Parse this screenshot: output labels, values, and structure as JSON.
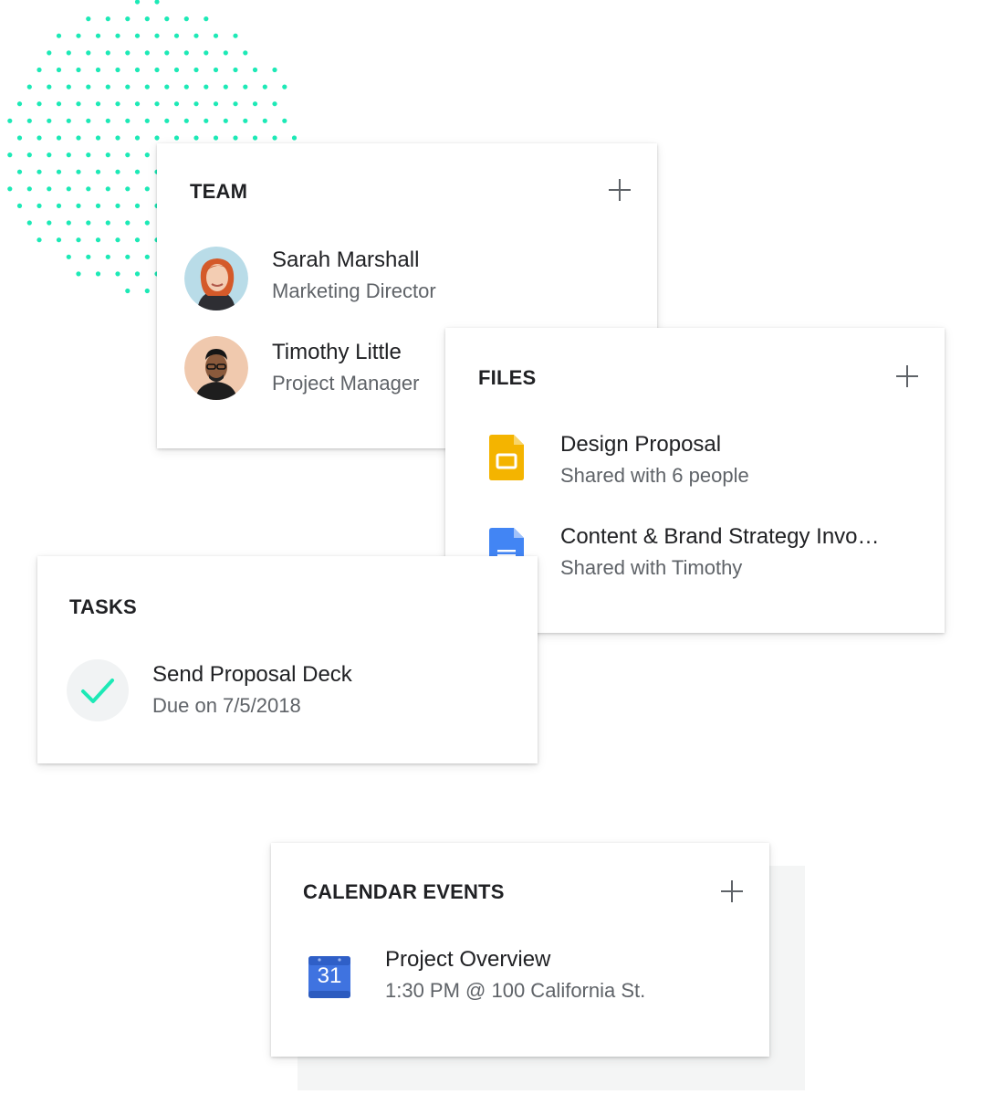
{
  "team": {
    "title": "TEAM",
    "members": [
      {
        "name": "Sarah Marshall",
        "role": "Marketing Director"
      },
      {
        "name": "Timothy Little",
        "role": "Project Manager"
      }
    ]
  },
  "files": {
    "title": "FILES",
    "items": [
      {
        "name": "Design Proposal",
        "detail": "Shared with 6 people",
        "icon": "google-slides-icon"
      },
      {
        "name": "Content & Brand Strategy Invo…",
        "detail": "Shared with Timothy",
        "icon": "google-docs-icon"
      }
    ]
  },
  "tasks": {
    "title": "TASKS",
    "items": [
      {
        "name": "Send Proposal Deck",
        "due": "Due on 7/5/2018"
      }
    ]
  },
  "calendar": {
    "title": "CALENDAR EVENTS",
    "events": [
      {
        "name": "Project Overview",
        "detail": "1:30 PM @ 100 California St.",
        "day": "31",
        "icon": "google-calendar-icon"
      }
    ]
  },
  "colors": {
    "accent_teal": "#1de9b6",
    "slides_yellow": "#f4b400",
    "docs_blue": "#4285f4",
    "calendar_blue": "#3f73e0"
  }
}
